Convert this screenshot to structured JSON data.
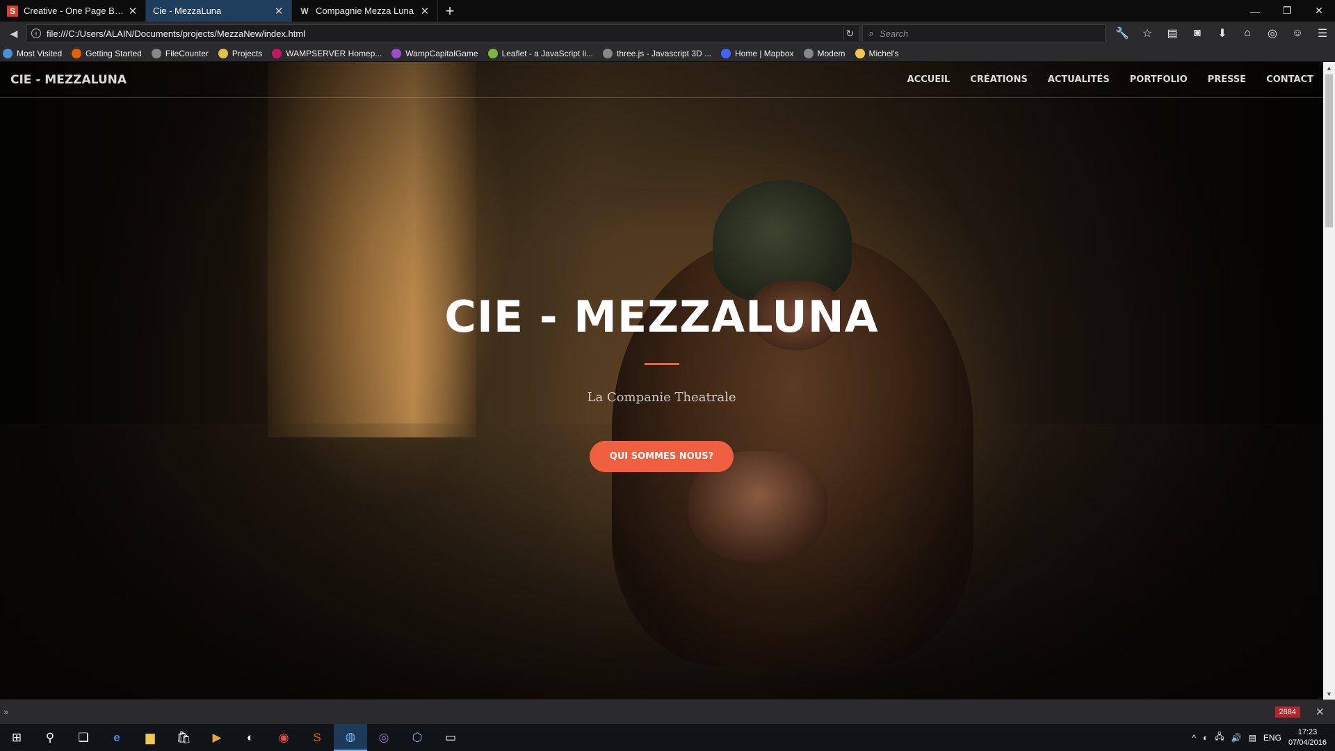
{
  "browser": {
    "tabs": [
      {
        "label": "Creative - One Page Boots...",
        "favicon": "S",
        "favicon_color": "#d9402b",
        "active": false
      },
      {
        "label": "Cie - MezzaLuna",
        "favicon": "",
        "favicon_color": "",
        "active": true
      },
      {
        "label": "Compagnie Mezza Luna",
        "favicon": "W",
        "favicon_color": "#cfcfcf",
        "active": false
      }
    ],
    "url": "file:///C:/Users/ALAIN/Documents/projects/MezzaNew/index.html",
    "search_placeholder": "Search",
    "bookmarks": [
      {
        "label": "Most Visited",
        "color": "#4a90d9"
      },
      {
        "label": "Getting Started",
        "color": "#e66000"
      },
      {
        "label": "FileCounter",
        "color": "#888888"
      },
      {
        "label": "Projects",
        "color": "#e0c34a"
      },
      {
        "label": "WAMPSERVER Homep...",
        "color": "#c2185b"
      },
      {
        "label": "WampCapitalGame",
        "color": "#9c4dcc"
      },
      {
        "label": "Leaflet - a JavaScript li...",
        "color": "#7cb342"
      },
      {
        "label": "three.js - Javascript 3D ...",
        "color": "#888888"
      },
      {
        "label": "Home | Mapbox",
        "color": "#4264fb"
      },
      {
        "label": "Modem",
        "color": "#888888"
      },
      {
        "label": "Michel's",
        "color": "#f2c94c"
      }
    ]
  },
  "site": {
    "brand": "CIE - MEZZALUNA",
    "menu": [
      "ACCUEIL",
      "CRÉATIONS",
      "ACTUALITÉS",
      "PORTFOLIO",
      "PRESSE",
      "CONTACT"
    ],
    "hero_title": "CIE - MEZZALUNA",
    "hero_subtitle": "La Companie Theatrale",
    "cta_label": "QUI SOMMES NOUS?",
    "accent_color": "#f05f40"
  },
  "devstrip": {
    "count": "2884"
  },
  "taskbar": {
    "language": "ENG",
    "time": "17:23",
    "date": "07/04/2016"
  }
}
